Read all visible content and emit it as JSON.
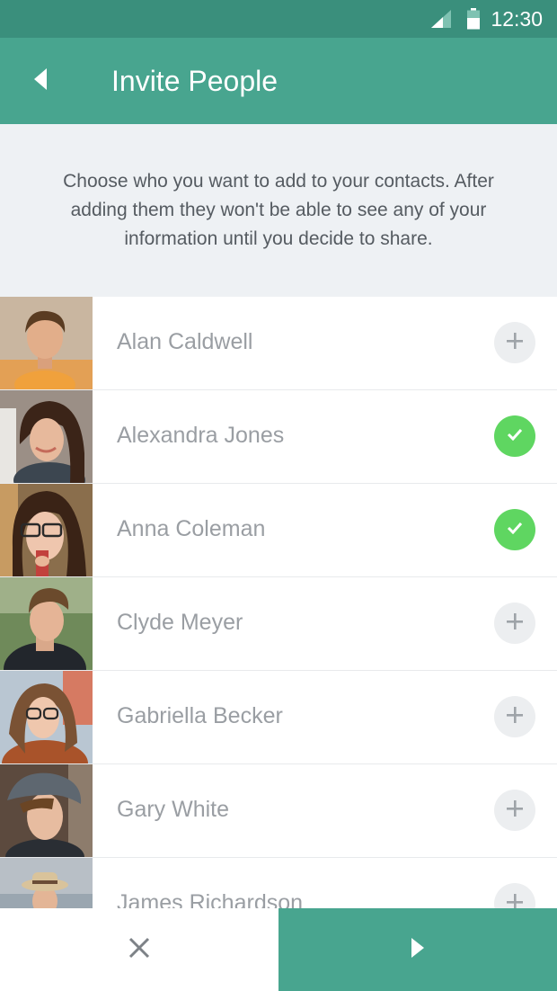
{
  "status_bar": {
    "time": "12:30",
    "signal_icon": "signal-icon",
    "battery_icon": "battery-icon"
  },
  "app_bar": {
    "title": "Invite People",
    "back_icon": "back-arrow-icon",
    "color": "#48a58f"
  },
  "intro": {
    "text": "Choose who you want to add to your contacts. After adding them they won't be able to see any of your information until you decide to share."
  },
  "contacts": [
    {
      "name": "Alan Caldwell",
      "selected": false
    },
    {
      "name": "Alexandra Jones",
      "selected": true
    },
    {
      "name": "Anna Coleman",
      "selected": true
    },
    {
      "name": "Clyde Meyer",
      "selected": false
    },
    {
      "name": "Gabriella Becker",
      "selected": false
    },
    {
      "name": "Gary White",
      "selected": false
    },
    {
      "name": "James Richardson",
      "selected": false
    }
  ],
  "bottom_bar": {
    "cancel_icon": "close-icon",
    "next_icon": "arrow-right-icon"
  },
  "colors": {
    "accent": "#48a58f",
    "status_bar": "#3a8f7c",
    "selected": "#5fd661",
    "unselected": "#eceef0"
  }
}
